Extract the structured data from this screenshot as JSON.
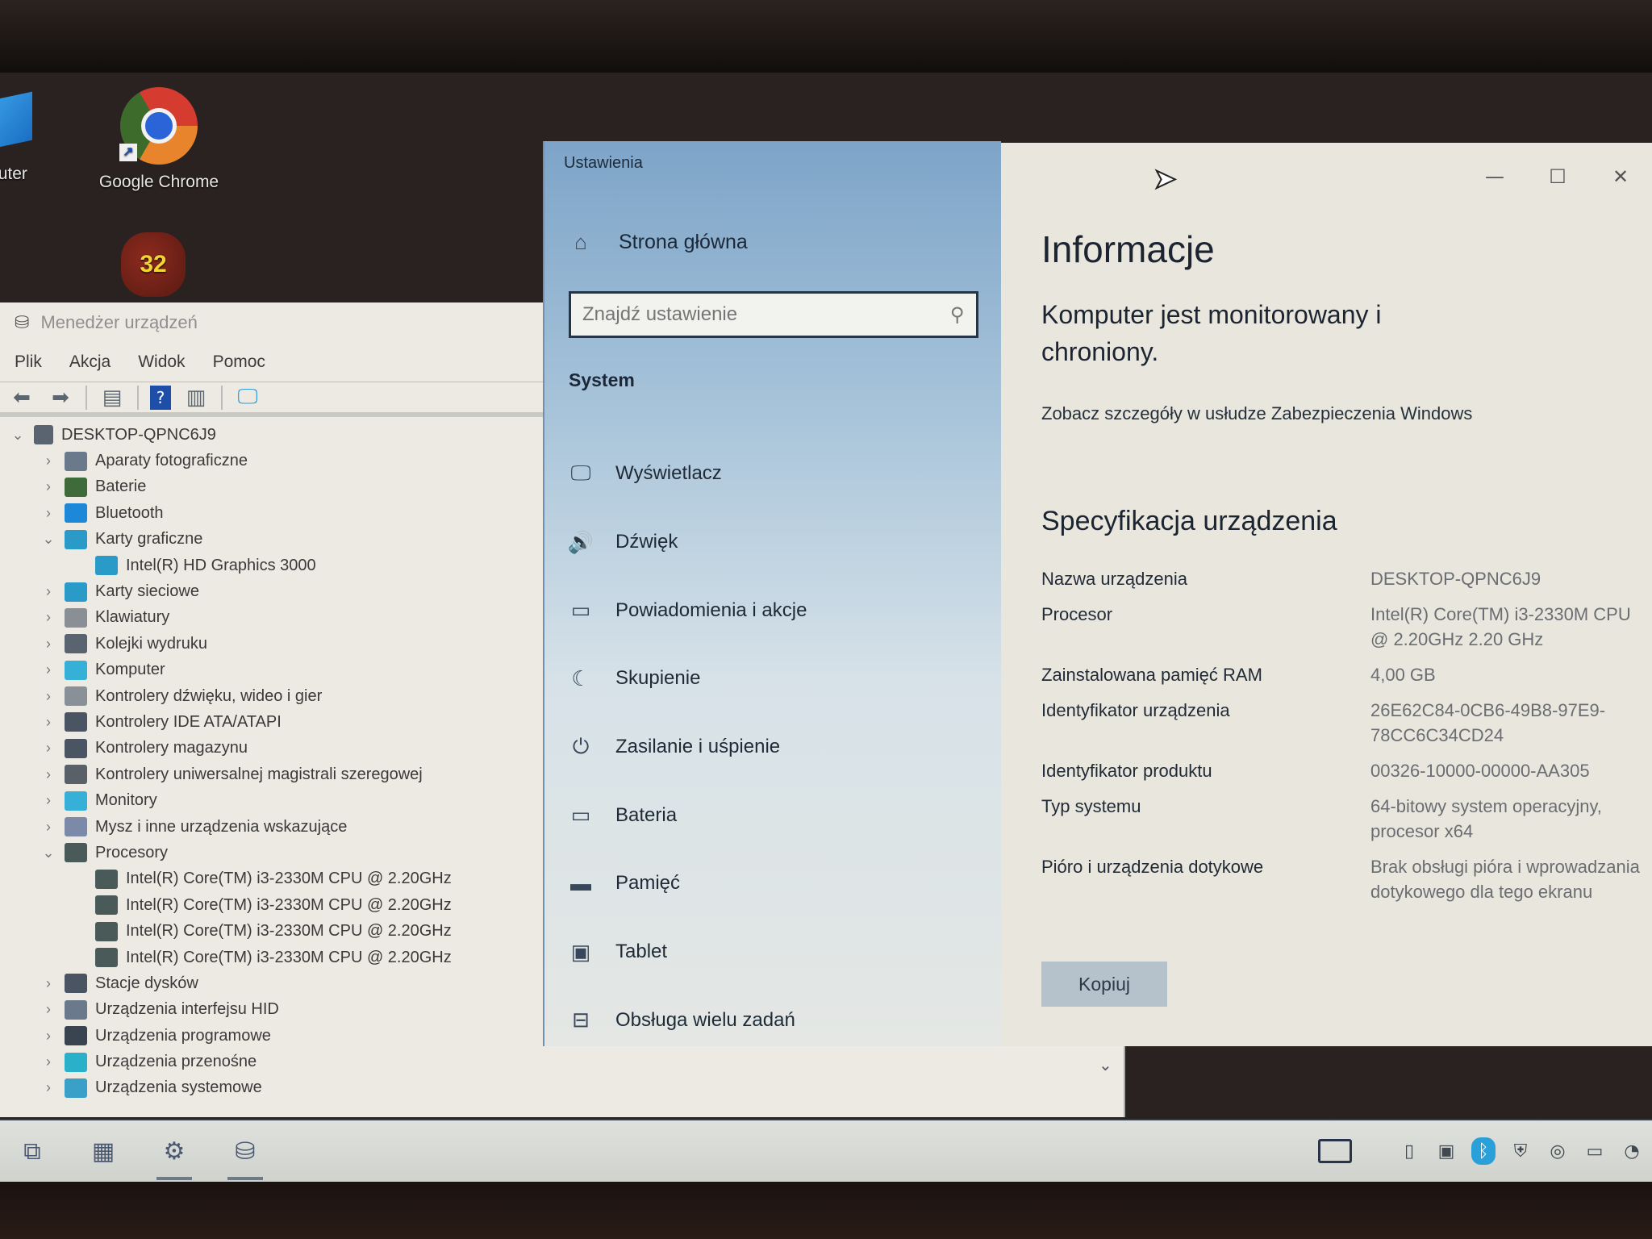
{
  "desktop": {
    "icons": [
      {
        "label": "puter"
      },
      {
        "label": "Google Chrome"
      },
      {
        "label": "32"
      }
    ]
  },
  "device_manager": {
    "title": "Menedżer urządzeń",
    "menu": [
      "Plik",
      "Akcja",
      "Widok",
      "Pomoc"
    ],
    "root": "DESKTOP-QPNC6J9",
    "tree": [
      {
        "label": "Aparaty fotograficzne",
        "expanded": false,
        "level": 1,
        "icon_color": "#6a7a8c"
      },
      {
        "label": "Baterie",
        "expanded": false,
        "level": 1,
        "icon_color": "#3f6a3a"
      },
      {
        "label": "Bluetooth",
        "expanded": false,
        "level": 1,
        "icon_color": "#1e88d8"
      },
      {
        "label": "Karty graficzne",
        "expanded": true,
        "level": 1,
        "icon_color": "#2a9ac8"
      },
      {
        "label": "Intel(R) HD Graphics 3000",
        "level": 2,
        "icon_color": "#2a9ac8"
      },
      {
        "label": "Karty sieciowe",
        "expanded": false,
        "level": 1,
        "icon_color": "#2a9ac8"
      },
      {
        "label": "Klawiatury",
        "expanded": false,
        "level": 1,
        "icon_color": "#8a8f96"
      },
      {
        "label": "Kolejki wydruku",
        "expanded": false,
        "level": 1,
        "icon_color": "#5a6470"
      },
      {
        "label": "Komputer",
        "expanded": false,
        "level": 1,
        "icon_color": "#36b0d6"
      },
      {
        "label": "Kontrolery dźwięku, wideo i gier",
        "expanded": false,
        "level": 1,
        "icon_color": "#8a9098"
      },
      {
        "label": "Kontrolery IDE ATA/ATAPI",
        "expanded": false,
        "level": 1,
        "icon_color": "#4a5462"
      },
      {
        "label": "Kontrolery magazynu",
        "expanded": false,
        "level": 1,
        "icon_color": "#4a5462"
      },
      {
        "label": "Kontrolery uniwersalnej magistrali szeregowej",
        "expanded": false,
        "level": 1,
        "icon_color": "#5a6068"
      },
      {
        "label": "Monitory",
        "expanded": false,
        "level": 1,
        "icon_color": "#36b0d6"
      },
      {
        "label": "Mysz i inne urządzenia wskazujące",
        "expanded": false,
        "level": 1,
        "icon_color": "#7a8aa8"
      },
      {
        "label": "Procesory",
        "expanded": true,
        "level": 1,
        "icon_color": "#4a5a58"
      },
      {
        "label": "Intel(R) Core(TM) i3-2330M CPU @ 2.20GHz",
        "level": 2,
        "icon_color": "#4a5a58"
      },
      {
        "label": "Intel(R) Core(TM) i3-2330M CPU @ 2.20GHz",
        "level": 2,
        "icon_color": "#4a5a58"
      },
      {
        "label": "Intel(R) Core(TM) i3-2330M CPU @ 2.20GHz",
        "level": 2,
        "icon_color": "#4a5a58"
      },
      {
        "label": "Intel(R) Core(TM) i3-2330M CPU @ 2.20GHz",
        "level": 2,
        "icon_color": "#4a5a58"
      },
      {
        "label": "Stacje dysków",
        "expanded": false,
        "level": 1,
        "icon_color": "#4a5462"
      },
      {
        "label": "Urządzenia interfejsu HID",
        "expanded": false,
        "level": 1,
        "icon_color": "#6a7a8c"
      },
      {
        "label": "Urządzenia programowe",
        "expanded": false,
        "level": 1,
        "icon_color": "#3a4450"
      },
      {
        "label": "Urządzenia przenośne",
        "expanded": false,
        "level": 1,
        "icon_color": "#2ab0c8"
      },
      {
        "label": "Urządzenia systemowe",
        "expanded": false,
        "level": 1,
        "icon_color": "#3aa0c8"
      }
    ]
  },
  "settings": {
    "app_title": "Ustawienia",
    "home_label": "Strona główna",
    "search": {
      "placeholder": "Znajdź ustawienie",
      "value": ""
    },
    "section_label": "System",
    "nav_items": [
      {
        "label": "Wyświetlacz",
        "icon": "display-icon"
      },
      {
        "label": "Dźwięk",
        "icon": "sound-icon"
      },
      {
        "label": "Powiadomienia i akcje",
        "icon": "notifications-icon"
      },
      {
        "label": "Skupienie",
        "icon": "focus-moon-icon"
      },
      {
        "label": "Zasilanie i uśpienie",
        "icon": "power-icon"
      },
      {
        "label": "Bateria",
        "icon": "battery-icon"
      },
      {
        "label": "Pamięć",
        "icon": "storage-icon"
      },
      {
        "label": "Tablet",
        "icon": "tablet-icon"
      },
      {
        "label": "Obsługa wielu zadań",
        "icon": "multitasking-icon"
      }
    ],
    "window_controls": {
      "minimize": "—",
      "maximize": "☐",
      "close": "✕"
    },
    "content": {
      "title": "Informacje",
      "status": "Komputer jest monitorowany i chroniony.",
      "security_link": "Zobacz szczegóły w usłudze Zabezpieczenia Windows",
      "spec_title": "Specyfikacja urządzenia",
      "specs": [
        {
          "label": "Nazwa urządzenia",
          "value": "DESKTOP-QPNC6J9"
        },
        {
          "label": "Procesor",
          "value": "Intel(R) Core(TM) i3-2330M CPU @ 2.20GHz   2.20 GHz"
        },
        {
          "label": "Zainstalowana pamięć RAM",
          "value": "4,00 GB"
        },
        {
          "label": "Identyfikator urządzenia",
          "value": "26E62C84-0CB6-49B8-97E9-78CC6C34CD24"
        },
        {
          "label": "Identyfikator produktu",
          "value": "00326-10000-00000-AA305"
        },
        {
          "label": "Typ systemu",
          "value": "64-bitowy system operacyjny, procesor x64"
        },
        {
          "label": "Pióro i urządzenia dotykowe",
          "value": "Brak obsługi pióra i wprowadzania dotykowego dla tego ekranu"
        }
      ],
      "copy_label": "Kopiuj"
    }
  },
  "taskbar": {
    "pinned": [
      {
        "icon": "task-view-icon",
        "glyph": "⧉"
      },
      {
        "icon": "file-explorer-icon",
        "glyph": "▦"
      },
      {
        "icon": "settings-gear-icon",
        "glyph": "⚙"
      },
      {
        "icon": "device-manager-icon",
        "glyph": "⛁"
      }
    ],
    "tray": [
      {
        "icon": "usb-drive-icon",
        "glyph": "▯"
      },
      {
        "icon": "display-network-icon",
        "glyph": "▣"
      },
      {
        "icon": "bluetooth-icon",
        "glyph": "ᛒ"
      },
      {
        "icon": "security-shield-icon",
        "glyph": "⛨"
      },
      {
        "icon": "camera-icon",
        "glyph": "◎"
      },
      {
        "icon": "battery-plug-icon",
        "glyph": "▭"
      },
      {
        "icon": "wifi-icon",
        "glyph": "◔"
      }
    ]
  },
  "colors": {
    "settings_nav_top": "#7da4c8",
    "content_bg": "#e9e6dd",
    "copy_button": "#b5c2cc",
    "taskbar": "#dcdedb"
  }
}
